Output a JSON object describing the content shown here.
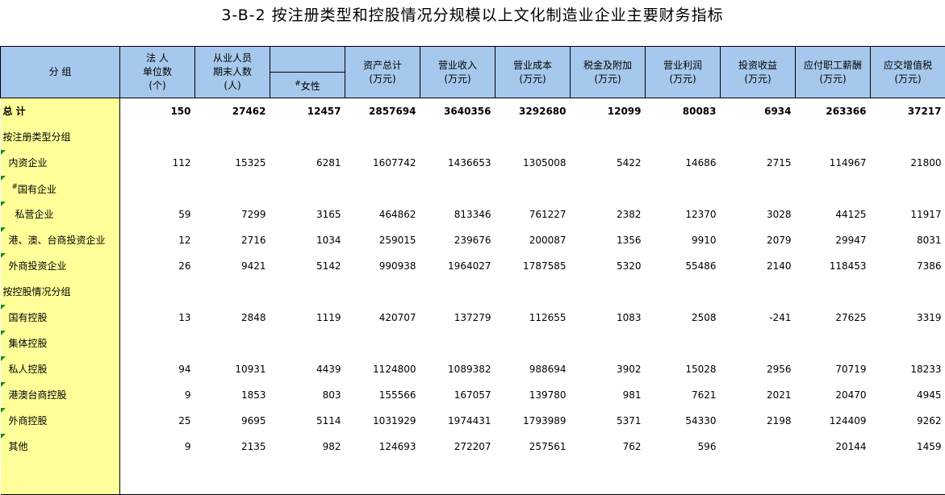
{
  "title": "3-B-2   按注册类型和控股情况分规模以上文化制造业企业主要财务指标",
  "headers": {
    "group": "分 组",
    "legal_l1": "法 人",
    "legal_l2": "单位数",
    "legal_l3": "(个)",
    "emp_l1": "从业人员",
    "emp_l2": "期末人数",
    "emp_l3": "(人)",
    "female_mark": "#",
    "female": "女性",
    "assets_l1": "资产总计",
    "assets_l2": "(万元)",
    "revenue_l1": "营业收入",
    "revenue_l2": "(万元)",
    "cost_l1": "营业成本",
    "cost_l2": "(万元)",
    "tax_l1": "税金及附加",
    "tax_l2": "(万元)",
    "profit_l1": "营业利润",
    "profit_l2": "(万元)",
    "invest_l1": "投资收益",
    "invest_l2": "(万元)",
    "payroll_l1": "应付职工薪酬",
    "payroll_l2": "(万元)",
    "vat_l1": "应交增值税",
    "vat_l2": "(万元)"
  },
  "rows": [
    {
      "name": "总 计",
      "values": [
        "150",
        "27462",
        "12457",
        "2857694",
        "3640356",
        "3292680",
        "12099",
        "80083",
        "6934",
        "263366",
        "37217"
      ]
    },
    {
      "name": "按注册类型分组",
      "values": [
        "",
        "",
        "",
        "",
        "",
        "",
        "",
        "",
        "",
        "",
        ""
      ]
    },
    {
      "name": "内资企业",
      "values": [
        "112",
        "15325",
        "6281",
        "1607742",
        "1436653",
        "1305008",
        "5422",
        "14686",
        "2715",
        "114967",
        "21800"
      ]
    },
    {
      "name_mark": "#",
      "name": "国有企业",
      "values": [
        "",
        "",
        "",
        "",
        "",
        "",
        "",
        "",
        "",
        "",
        ""
      ]
    },
    {
      "name": "私营企业",
      "values": [
        "59",
        "7299",
        "3165",
        "464862",
        "813346",
        "761227",
        "2382",
        "12370",
        "3028",
        "44125",
        "11917"
      ]
    },
    {
      "name": "港、澳、台商投资企业",
      "values": [
        "12",
        "2716",
        "1034",
        "259015",
        "239676",
        "200087",
        "1356",
        "9910",
        "2079",
        "29947",
        "8031"
      ]
    },
    {
      "name": "外商投资企业",
      "values": [
        "26",
        "9421",
        "5142",
        "990938",
        "1964027",
        "1787585",
        "5320",
        "55486",
        "2140",
        "118453",
        "7386"
      ]
    },
    {
      "name": "按控股情况分组",
      "values": [
        "",
        "",
        "",
        "",
        "",
        "",
        "",
        "",
        "",
        "",
        ""
      ]
    },
    {
      "name": "国有控股",
      "values": [
        "13",
        "2848",
        "1119",
        "420707",
        "137279",
        "112655",
        "1083",
        "2508",
        "-241",
        "27625",
        "3319"
      ]
    },
    {
      "name": "集体控股",
      "values": [
        "",
        "",
        "",
        "",
        "",
        "",
        "",
        "",
        "",
        "",
        ""
      ]
    },
    {
      "name": "私人控股",
      "values": [
        "94",
        "10931",
        "4439",
        "1124800",
        "1089382",
        "988694",
        "3902",
        "15028",
        "2956",
        "70719",
        "18233"
      ]
    },
    {
      "name": "港澳台商控股",
      "values": [
        "9",
        "1853",
        "803",
        "155566",
        "167057",
        "139780",
        "981",
        "7621",
        "2021",
        "20470",
        "4945"
      ]
    },
    {
      "name": "外商控股",
      "values": [
        "25",
        "9695",
        "5114",
        "1031929",
        "1974431",
        "1793989",
        "5371",
        "54330",
        "2198",
        "124409",
        "9262"
      ]
    },
    {
      "name": "其他",
      "values": [
        "9",
        "2135",
        "982",
        "124693",
        "272207",
        "257561",
        "762",
        "596",
        "",
        "20144",
        "1459"
      ]
    }
  ]
}
